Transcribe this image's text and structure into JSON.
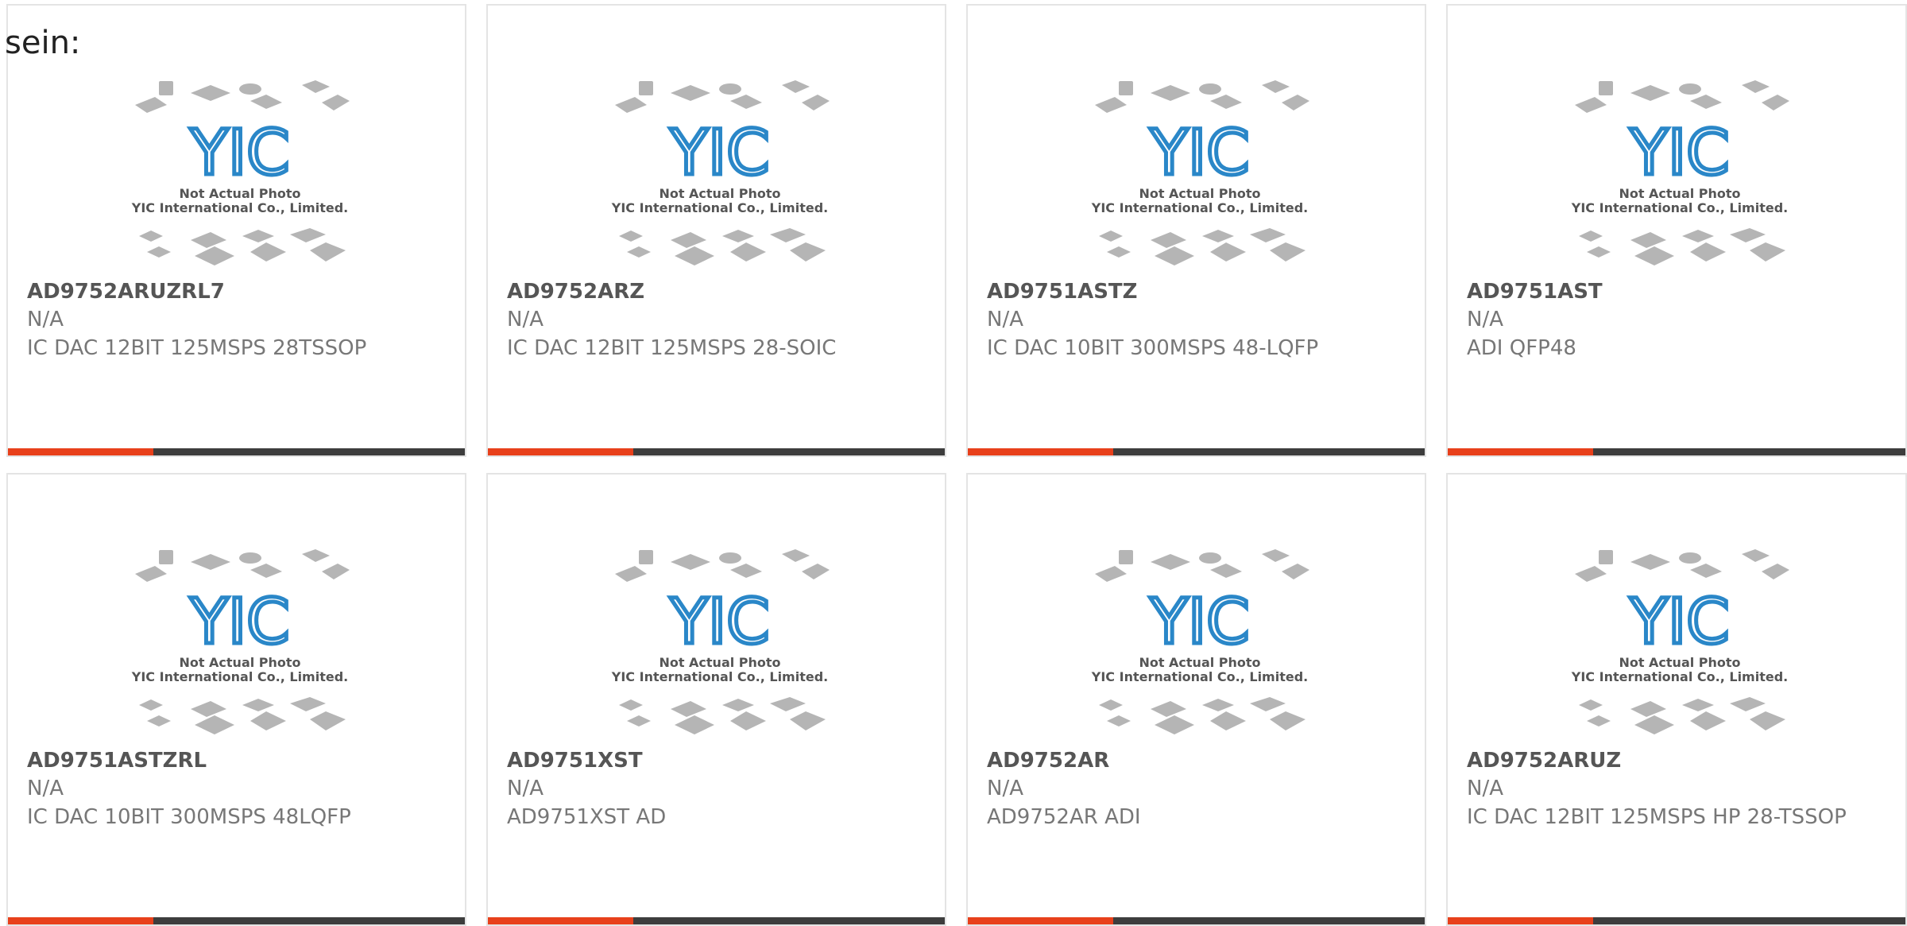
{
  "header": {
    "text": "sein:"
  },
  "placeholder_image": {
    "line1": "Not Actual Photo",
    "line2": "YIC International Co., Limited.",
    "logo_text": "YIC"
  },
  "colors": {
    "accent": "#e8401b",
    "bar": "#3d3d3d",
    "logo": "#2a87c8"
  },
  "products": [
    {
      "part": "AD9752ARUZRL7",
      "mfr": "N/A",
      "desc": "IC DAC 12BIT 125MSPS 28TSSOP"
    },
    {
      "part": "AD9752ARZ",
      "mfr": "N/A",
      "desc": "IC DAC 12BIT 125MSPS 28-SOIC"
    },
    {
      "part": "AD9751ASTZ",
      "mfr": "N/A",
      "desc": "IC DAC 10BIT 300MSPS 48-LQFP"
    },
    {
      "part": "AD9751AST",
      "mfr": "N/A",
      "desc": "ADI QFP48"
    },
    {
      "part": "AD9751ASTZRL",
      "mfr": "N/A",
      "desc": "IC DAC 10BIT 300MSPS 48LQFP"
    },
    {
      "part": "AD9751XST",
      "mfr": "N/A",
      "desc": "AD9751XST AD"
    },
    {
      "part": "AD9752AR",
      "mfr": "N/A",
      "desc": "AD9752AR ADI"
    },
    {
      "part": "AD9752ARUZ",
      "mfr": "N/A",
      "desc": "IC DAC 12BIT 125MSPS HP 28-TSSOP"
    }
  ]
}
